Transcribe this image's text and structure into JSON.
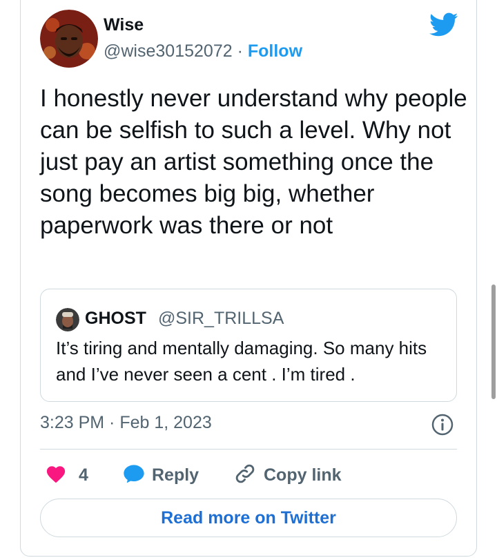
{
  "author": {
    "name": "Wise",
    "handle": "@wise30152072",
    "separator": "·",
    "follow_label": "Follow"
  },
  "tweet": {
    "text": "I honestly never understand why people can be selfish to such a level. Why not just pay an artist something once the song becomes big big, whether paperwork was there or not",
    "timestamp": "3:23 PM · Feb 1, 2023"
  },
  "quoted_tweet": {
    "name": "GHOST",
    "handle": "@SIR_TRILLSA",
    "text": "It’s tiring and mentally damaging. So many hits and I’ve never seen a cent . I’m tired ."
  },
  "actions": {
    "like_count": "4",
    "reply_label": "Reply",
    "copy_link_label": "Copy link"
  },
  "read_more_label": "Read more on Twitter",
  "icons": {
    "brand": "twitter-bird-icon",
    "like": "heart-icon",
    "reply": "speech-bubble-icon",
    "copy_link": "link-icon",
    "info": "info-icon"
  },
  "colors": {
    "brand_blue": "#1d9bf0",
    "link_blue": "#1d6fd4",
    "heart_pink": "#f91880",
    "text_primary": "#0f1419",
    "text_secondary": "#536471",
    "border": "#cfd9de"
  }
}
